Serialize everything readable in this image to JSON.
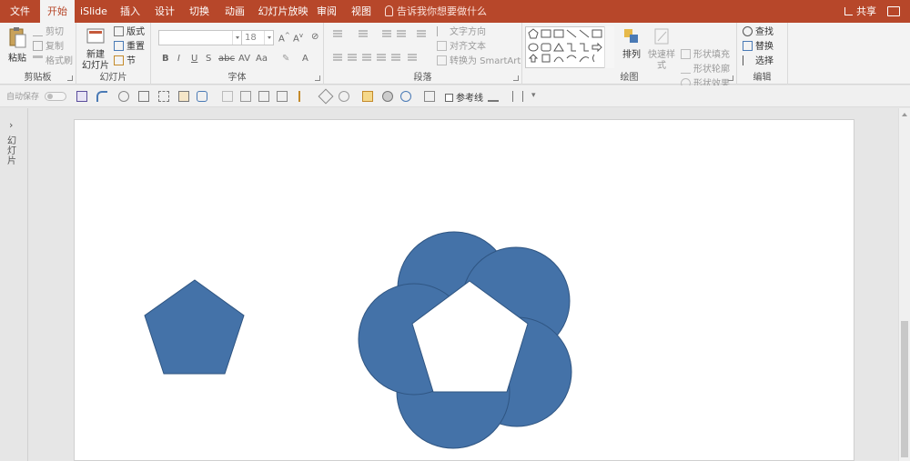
{
  "tabs": [
    {
      "label": "文件",
      "name": "tab-file"
    },
    {
      "label": "开始",
      "name": "tab-home"
    },
    {
      "label": "iSlide",
      "name": "tab-islide"
    },
    {
      "label": "插入",
      "name": "tab-insert"
    },
    {
      "label": "设计",
      "name": "tab-design"
    },
    {
      "label": "切换",
      "name": "tab-transitions"
    },
    {
      "label": "动画",
      "name": "tab-animations"
    },
    {
      "label": "幻灯片放映",
      "name": "tab-slideshow"
    },
    {
      "label": "审阅",
      "name": "tab-review"
    },
    {
      "label": "视图",
      "name": "tab-view"
    }
  ],
  "active_tab": "开始",
  "tell_me": "告诉我你想要做什么",
  "share": "共享",
  "clipboard": {
    "paste": "粘贴",
    "cut": "剪切",
    "copy": "复制",
    "format_painter": "格式刷",
    "label": "剪贴板"
  },
  "slides_group": {
    "new_slide_line1": "新建",
    "new_slide_line2": "幻灯片",
    "layout": "版式",
    "reset": "重置",
    "section": "节",
    "label": "幻灯片"
  },
  "font_group": {
    "font_name": "",
    "font_size": "18",
    "label": "字体"
  },
  "paragraph_group": {
    "text_direction": "文字方向",
    "align_text": "对齐文本",
    "smartart": "转换为 SmartArt",
    "label": "段落"
  },
  "drawing_group": {
    "arrange": "排列",
    "quick_styles": "快速样式",
    "shape_fill": "形状填充",
    "shape_outline": "形状轮廓",
    "shape_effects": "形状效果",
    "label": "绘图"
  },
  "editing_group": {
    "find": "查找",
    "replace": "替换",
    "select": "选择",
    "label": "编辑"
  },
  "qat": {
    "autosave": "自动保存",
    "reference_line": "参考线"
  },
  "left_pane": {
    "label": "幻灯片"
  },
  "colors": {
    "accent": "#b7472a",
    "shape_fill": "#4472a8",
    "shape_stroke": "#2f5582"
  }
}
